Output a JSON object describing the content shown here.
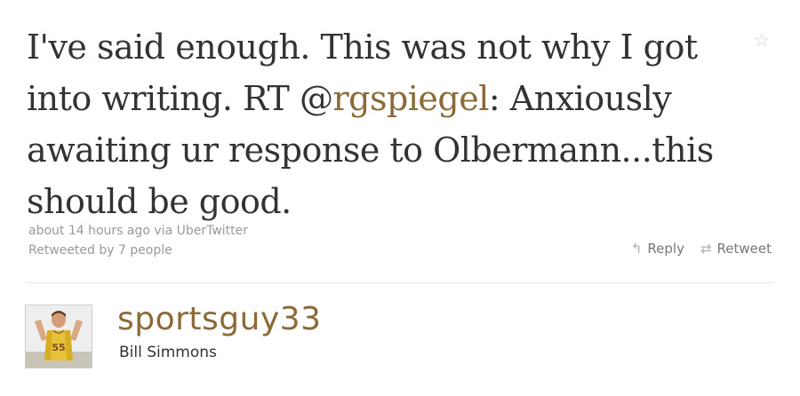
{
  "tweet": {
    "text_before": "I've said enough. This was not why I got into writing. RT @",
    "mention": "rgspiegel",
    "text_after": ": Anxiously awaiting ur response to Olbermann...this should be good.",
    "timestamp": "about 14 hours ago via UberTwitter",
    "retweeted_by": "Retweeted by 7 people"
  },
  "actions": {
    "reply_label": "Reply",
    "retweet_label": "Retweet",
    "reply_icon": "reply-arrow-icon",
    "retweet_icon": "retweet-icon",
    "favorite_icon": "star-icon"
  },
  "author": {
    "screen_name": "sportsguy33",
    "full_name": "Bill Simmons",
    "jersey_number": "55"
  },
  "colors": {
    "link": "#8b6a37",
    "text": "#333333",
    "meta": "#999999"
  }
}
